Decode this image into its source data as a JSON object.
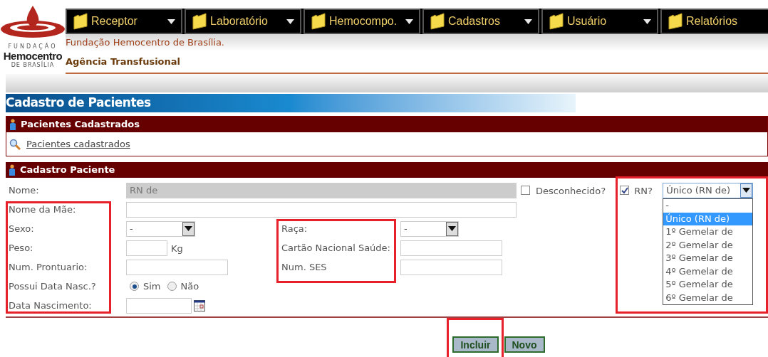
{
  "logo": {
    "top": "FUNDAÇÃO",
    "name": "Hemocentro",
    "bottom": "DE BRASÍLIA"
  },
  "menu": [
    {
      "label": "Receptor",
      "has_arrow": true
    },
    {
      "label": "Laboratório",
      "has_arrow": true
    },
    {
      "label": "Hemocompo.",
      "has_arrow": true
    },
    {
      "label": "Cadastros",
      "has_arrow": true
    },
    {
      "label": "Usuário",
      "has_arrow": true
    },
    {
      "label": "Relatórios",
      "has_arrow": false
    }
  ],
  "header": {
    "organization": "Fundação Hemocentro de Brasília.",
    "unit": "Agência Transfusional"
  },
  "page_title": "Cadastro de Pacientes",
  "section_list": {
    "title": "Pacientes Cadastrados",
    "link": "Pacientes cadastrados"
  },
  "section_form": {
    "title": "Cadastro Paciente",
    "nome": {
      "label": "Nome:",
      "value": "RN de",
      "disabled": true
    },
    "desconhecido": {
      "label": "Desconhecido?",
      "checked": false
    },
    "rn": {
      "label": "RN?",
      "checked": true,
      "value": "Único (RN de)",
      "expanded": true,
      "options": [
        {
          "label": "-",
          "selected": false
        },
        {
          "label": "Único (RN de)",
          "selected": true
        },
        {
          "label": "1º Gemelar de",
          "selected": false
        },
        {
          "label": "2º Gemelar de",
          "selected": false
        },
        {
          "label": "3º Gemelar de",
          "selected": false
        },
        {
          "label": "4º Gemelar de",
          "selected": false
        },
        {
          "label": "5º Gemelar de",
          "selected": false
        },
        {
          "label": "6º Gemelar de",
          "selected": false
        }
      ]
    },
    "nome_mae": {
      "label": "Nome da Mãe:"
    },
    "sexo": {
      "label": "Sexo:",
      "value": "-"
    },
    "raca": {
      "label": "Raça:",
      "value": "-"
    },
    "peso": {
      "label": "Peso:",
      "unit": "Kg"
    },
    "cartao": {
      "label": "Cartão Nacional Saúde:"
    },
    "prontuario": {
      "label": "Num. Prontuario:"
    },
    "ses": {
      "label": "Num. SES"
    },
    "possui_data": {
      "label": "Possui Data Nasc.?",
      "options": [
        {
          "label": "Sim",
          "selected": true
        },
        {
          "label": "Não",
          "selected": false
        }
      ]
    },
    "data_nascimento": {
      "label": "Data Nascimento:"
    }
  },
  "buttons": [
    {
      "label": "Incluir"
    },
    {
      "label": "Novo"
    }
  ]
}
